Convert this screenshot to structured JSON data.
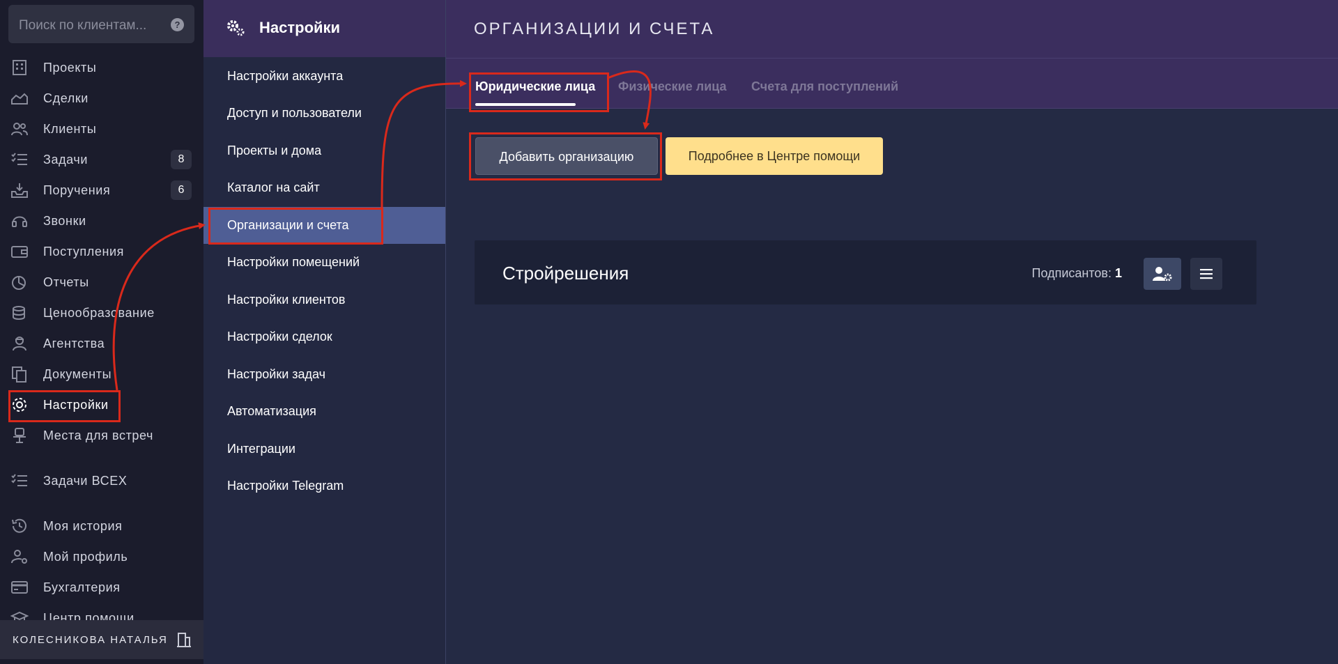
{
  "search": {
    "placeholder": "Поиск по клиентам..."
  },
  "sidebar": {
    "items": [
      {
        "label": "Проекты",
        "icon": "building-icon"
      },
      {
        "label": "Сделки",
        "icon": "deal-icon"
      },
      {
        "label": "Клиенты",
        "icon": "users-icon"
      },
      {
        "label": "Задачи",
        "icon": "tasks-icon",
        "badge": "8"
      },
      {
        "label": "Поручения",
        "icon": "inbox-icon",
        "badge": "6"
      },
      {
        "label": "Звонки",
        "icon": "headset-icon"
      },
      {
        "label": "Поступления",
        "icon": "wallet-icon"
      },
      {
        "label": "Отчеты",
        "icon": "pie-chart-icon"
      },
      {
        "label": "Ценообразование",
        "icon": "coins-icon"
      },
      {
        "label": "Агентства",
        "icon": "agent-icon"
      },
      {
        "label": "Документы",
        "icon": "documents-icon"
      },
      {
        "label": "Настройки",
        "icon": "gear-icon"
      },
      {
        "label": "Места для встреч",
        "icon": "meeting-place-icon"
      },
      {
        "label": "Задачи ВСЕХ",
        "icon": "tasks-icon"
      },
      {
        "label": "Моя история",
        "icon": "history-icon"
      },
      {
        "label": "Мой профиль",
        "icon": "user-gear-icon"
      },
      {
        "label": "Бухгалтерия",
        "icon": "card-icon"
      },
      {
        "label": "Центр помощи",
        "icon": "graduation-cap-icon"
      }
    ],
    "user": "КОЛЕСНИКОВА НАТАЛЬЯ"
  },
  "settings": {
    "title": "Настройки",
    "menu": [
      "Настройки аккаунта",
      "Доступ и пользователи",
      "Проекты и дома",
      "Каталог на сайт",
      "Организации и счета",
      "Настройки помещений",
      "Настройки клиентов",
      "Настройки сделок",
      "Настройки задач",
      "Автоматизация",
      "Интеграции",
      "Настройки Telegram"
    ],
    "active_index": 4
  },
  "main": {
    "title": "ОРГАНИЗАЦИИ И СЧЕТА",
    "tabs": [
      "Юридические лица",
      "Физические лица",
      "Счета для поступлений"
    ],
    "add_button": "Добавить организацию",
    "help_button": "Подробнее в Центре помощи",
    "org": {
      "name": "Стройрешения",
      "signers_label": "Подписантов:",
      "signers_count": "1"
    }
  },
  "colors": {
    "annotation": "#d9291b",
    "accent_active": "#4f5e95",
    "help_button": "#ffdf8c"
  }
}
